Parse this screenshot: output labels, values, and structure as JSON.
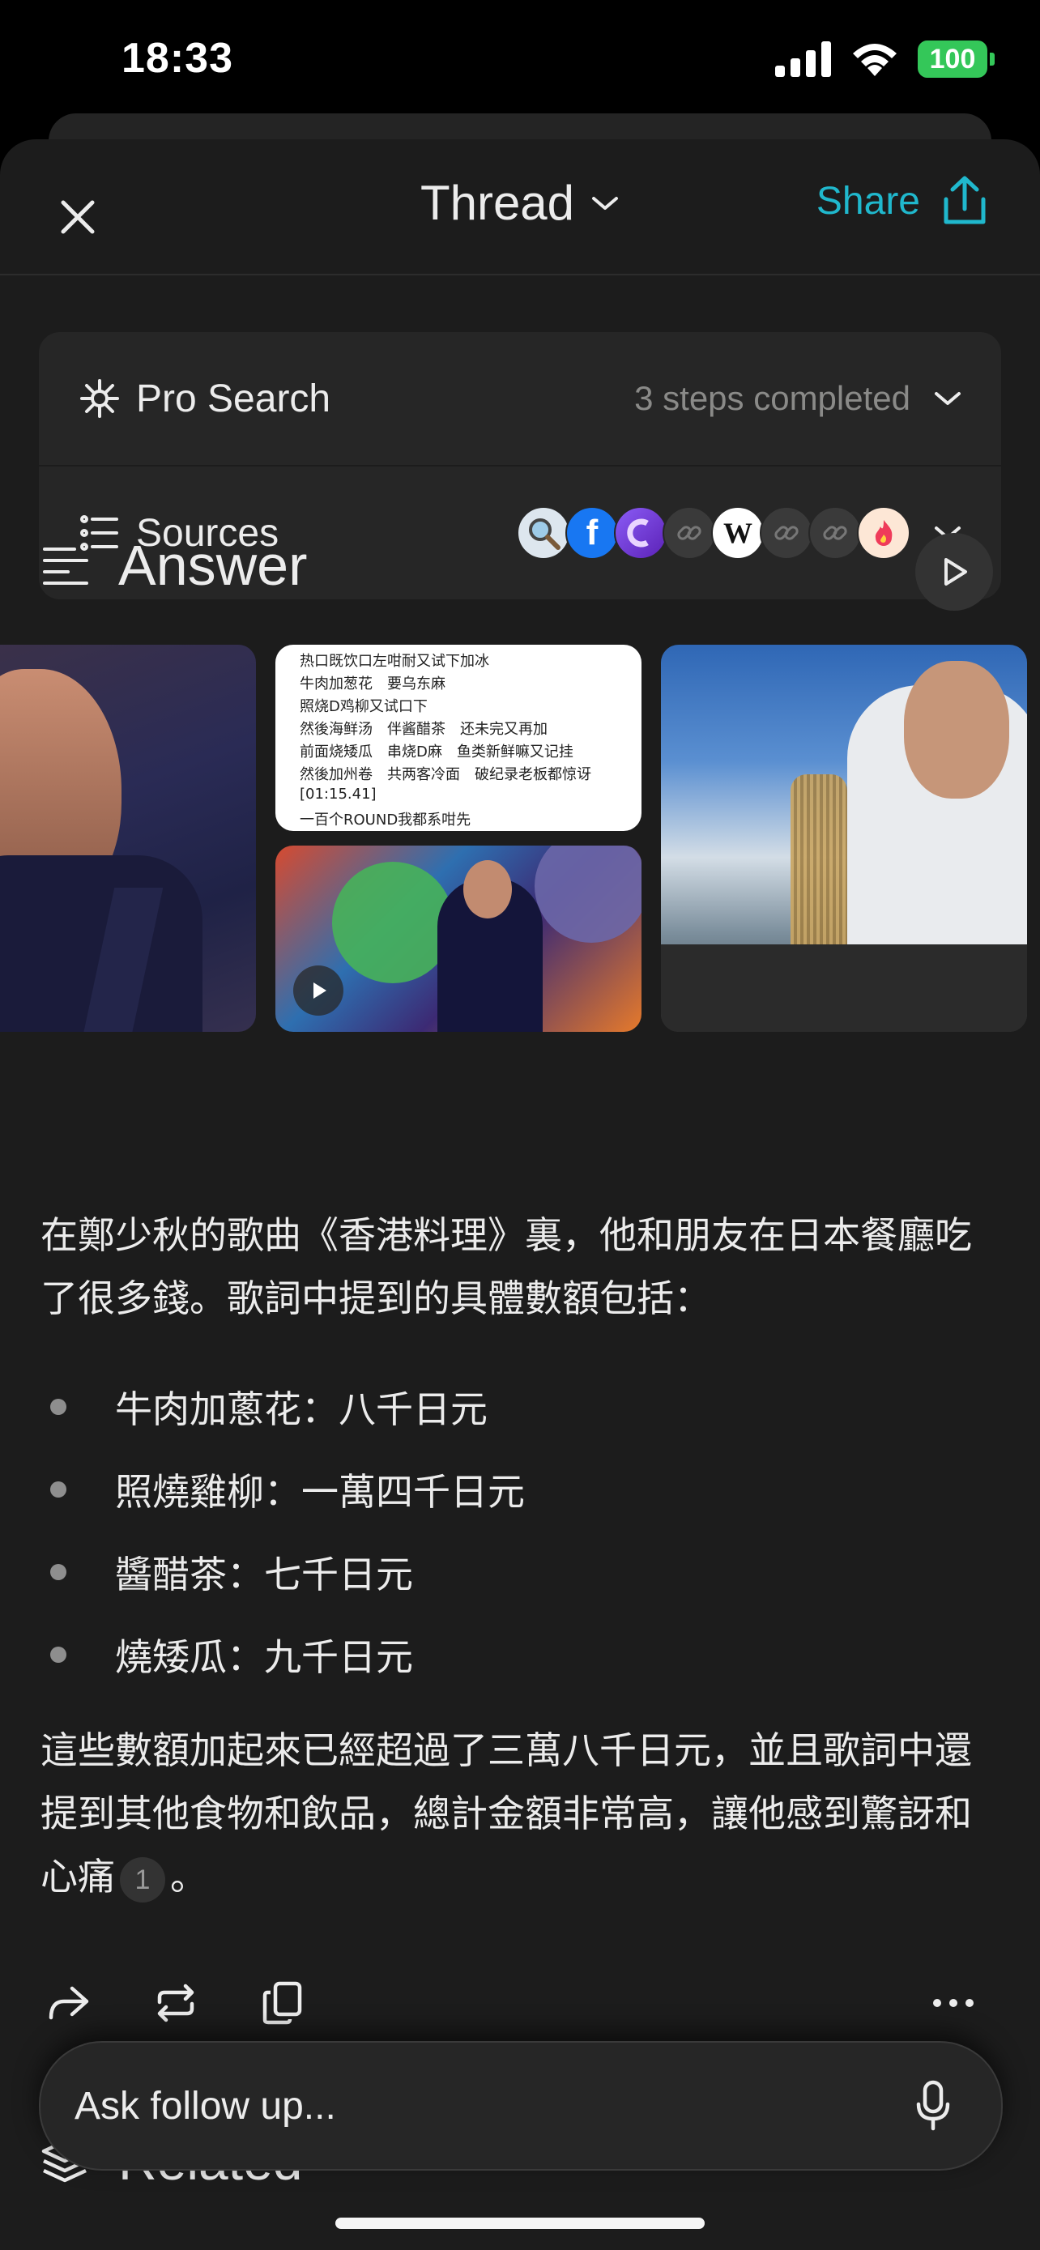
{
  "status_bar": {
    "time": "18:33",
    "battery": "100"
  },
  "header": {
    "title": "Thread",
    "share_label": "Share"
  },
  "pro_search": {
    "label": "Pro Search",
    "status": "3 steps completed"
  },
  "sources": {
    "label": "Sources",
    "favicons": [
      "search-favicon",
      "facebook-favicon",
      "purple-favicon",
      "link-favicon",
      "wikipedia-favicon",
      "link-favicon",
      "link-favicon",
      "fire-favicon"
    ],
    "wikipedia_letter": "W"
  },
  "answer": {
    "heading": "Answer",
    "lyrics_image": {
      "lines": [
        "热口既饮口左咁耐又试下加冰",
        "牛肉加葱花　要乌东麻",
        "照烧D鸡柳又试口下",
        "然後海鲜汤　伴酱醋茶　还未完又再加",
        "前面烧矮瓜　串烧D麻　鱼类新鲜嘛又记挂",
        "然後加州卷　共两客冷面　破纪录老板都惊讶",
        "[01:15.41]",
        "一百个ROUND我都系咁先"
      ]
    },
    "intro": "在鄭少秋的歌曲《香港料理》裏，他和朋友在日本餐廳吃了很多錢。歌詞中提到的具體數額包括：",
    "items": [
      "牛肉加蔥花：八千日元",
      "照燒雞柳：一萬四千日元",
      "醬醋茶：七千日元",
      "燒矮瓜：九千日元"
    ],
    "conclusion": "這些數額加起來已經超過了三萬八千日元，並且歌詞中還提到其他食物和飲品，總計金額非常高，讓他感到驚訝和心痛",
    "citation": "1",
    "end_mark": "。"
  },
  "related": {
    "label": "Related"
  },
  "follow_up": {
    "placeholder": "Ask follow up..."
  },
  "colors": {
    "accent": "#20b8cd",
    "background": "#1c1c1c",
    "card": "#262626"
  }
}
